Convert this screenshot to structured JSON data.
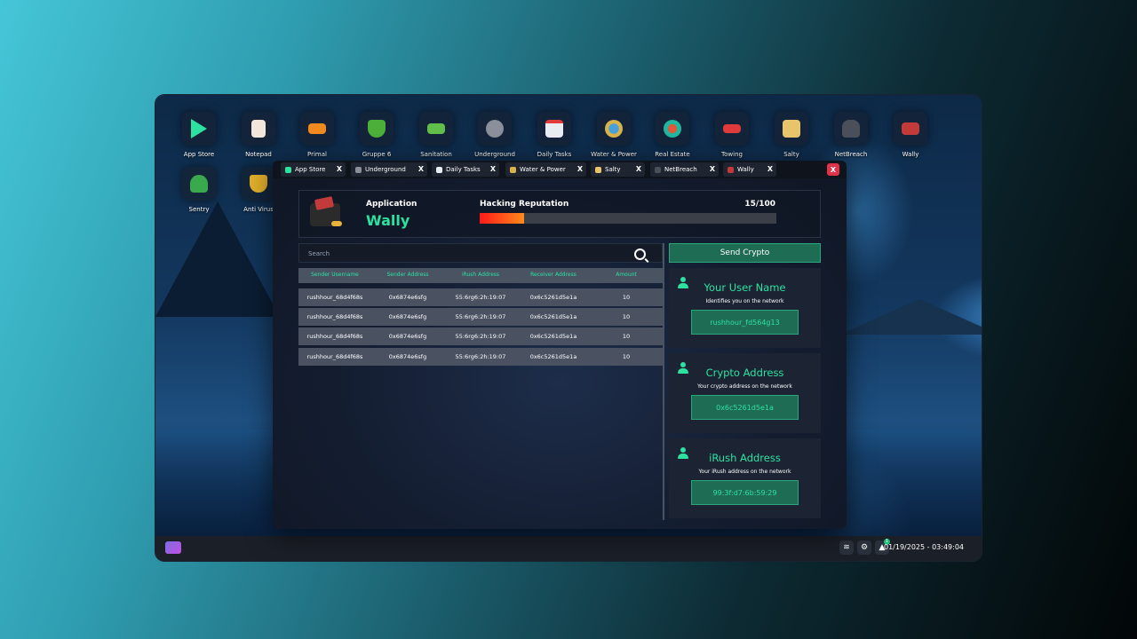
{
  "desktop": {
    "icons": [
      {
        "label": "App Store",
        "color": "#2de2a0"
      },
      {
        "label": "Notepad",
        "color": "#f2e6da"
      },
      {
        "label": "Primal",
        "color": "#f08a1e"
      },
      {
        "label": "Gruppe 6",
        "color": "#4caf3a"
      },
      {
        "label": "Sanitation",
        "color": "#5fbf4a"
      },
      {
        "label": "Underground",
        "color": "#8a8f99"
      },
      {
        "label": "Daily Tasks",
        "color": "#e9edf2"
      },
      {
        "label": "Water & Power",
        "color": "#d9b34a"
      },
      {
        "label": "Real Estate",
        "color": "#1fb7a0"
      },
      {
        "label": "Towing",
        "color": "#e03a3a"
      },
      {
        "label": "Salty",
        "color": "#e8c46a"
      },
      {
        "label": "NetBreach",
        "color": "#4a4f5a"
      },
      {
        "label": "Wally",
        "color": "#c23a3a"
      },
      {
        "label": "Sentry",
        "color": "#3aa84c"
      },
      {
        "label": "Anti Virus",
        "color": "#e2b02a"
      }
    ]
  },
  "taskbar": {
    "datetime": "01/19/2025 - 03:49:04",
    "notification_count": "1"
  },
  "window": {
    "tabs": [
      {
        "label": "App Store",
        "close": "X",
        "color": "#2de2a0"
      },
      {
        "label": "Underground",
        "close": "X",
        "color": "#8a8f99"
      },
      {
        "label": "Daily Tasks",
        "close": "X",
        "color": "#e9edf2"
      },
      {
        "label": "Water & Power",
        "close": "X",
        "color": "#d9b34a"
      },
      {
        "label": "Salty",
        "close": "X",
        "color": "#e8c46a"
      },
      {
        "label": "NetBreach",
        "close": "X",
        "color": "#4a4f5a"
      },
      {
        "label": "Wally",
        "close": "X",
        "color": "#c23a3a"
      }
    ],
    "close_label": "X"
  },
  "header": {
    "app_label": "Application",
    "app_name": "Wally",
    "rep_label": "Hacking Reputation",
    "rep_value": "15/100",
    "rep_fraction": 0.15
  },
  "search": {
    "placeholder": "Search"
  },
  "table": {
    "columns": [
      "Sender Username",
      "Sender Address",
      "iRush Address",
      "Receiver Address",
      "Amount"
    ],
    "rows": [
      [
        "rushhour_68d4f68s",
        "0x6874e6sfg",
        "55:6rg6:2h:19:07",
        "0x6c5261d5e1a",
        "10"
      ],
      [
        "rushhour_68d4f68s",
        "0x6874e6sfg",
        "55:6rg6:2h:19:07",
        "0x6c5261d5e1a",
        "10"
      ],
      [
        "rushhour_68d4f68s",
        "0x6874e6sfg",
        "55:6rg6:2h:19:07",
        "0x6c5261d5e1a",
        "10"
      ],
      [
        "rushhour_68d4f68s",
        "0x6874e6sfg",
        "55:6rg6:2h:19:07",
        "0x6c5261d5e1a",
        "10"
      ]
    ]
  },
  "send_crypto": {
    "label": "Send Crypto"
  },
  "cards": [
    {
      "title": "Your User Name",
      "subtitle": "Identifies you on the network",
      "value": "rushhour_fd564g13"
    },
    {
      "title": "Crypto Address",
      "subtitle": "Your crypto address on the network",
      "value": "0x6c5261d5e1a"
    },
    {
      "title": "iRush Address",
      "subtitle": "Your iRush address on the network",
      "value": "99:3f:d7:6b:59:29"
    }
  ],
  "colors": {
    "accent": "#2de2a0",
    "danger": "#e0334a",
    "button": "#1f6c55"
  }
}
